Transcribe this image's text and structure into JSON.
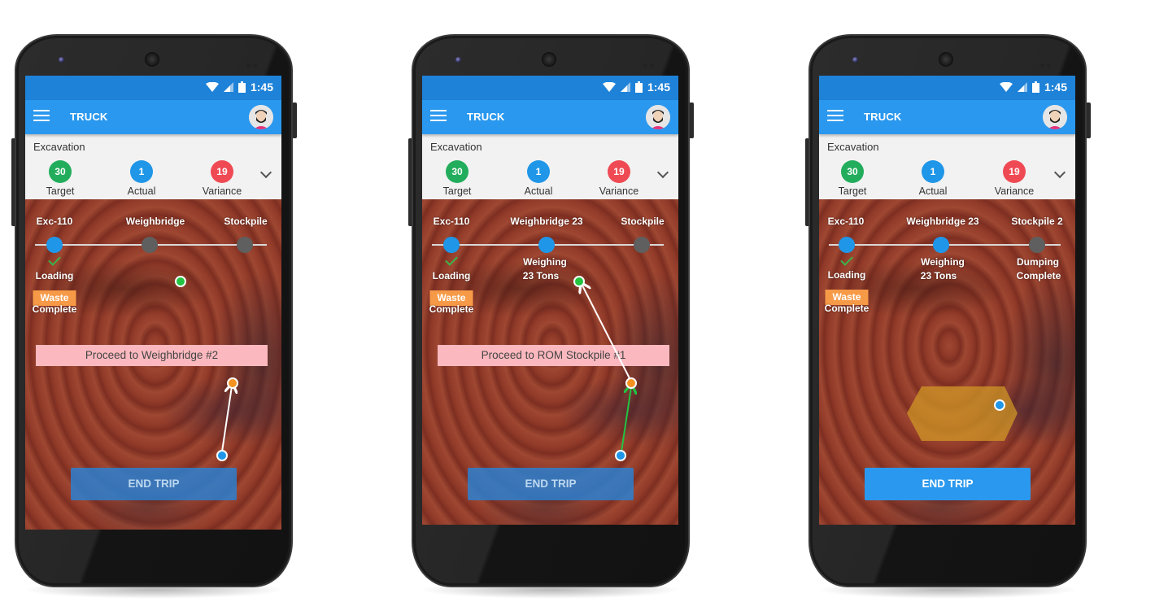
{
  "colors": {
    "statusbar": "#1e82d8",
    "appbar": "#2a98ee",
    "target": "#22ad5c",
    "actual": "#1f96e8",
    "variance": "#ef4a54",
    "waste_badge": "#f79a48",
    "banner_bg": "#fbb9bf",
    "active_node": "#1f96e8",
    "idle_node": "#5f5f5f",
    "geofence": "#d39a26"
  },
  "phones": [
    {
      "status": {
        "time": "1:45",
        "icons": [
          "wifi-icon",
          "signal-icon",
          "battery-icon"
        ]
      },
      "appbar": {
        "menu_icon": "hamburger-menu-icon",
        "title": "TRUCK",
        "avatar": "user-avatar"
      },
      "stats": {
        "section": "Excavation",
        "items": [
          {
            "value": "30",
            "label": "Target"
          },
          {
            "value": "1",
            "label": "Actual"
          },
          {
            "value": "19",
            "label": "Variance"
          }
        ],
        "expand_icon": "chevron-down-icon"
      },
      "steps": [
        {
          "title": "Exc-110",
          "state": "active",
          "done": true,
          "sub": "Loading",
          "badge": "Waste",
          "sub2": "Complete"
        },
        {
          "title": "Weighbridge",
          "state": "idle"
        },
        {
          "title": "Stockpile",
          "state": "idle"
        }
      ],
      "banner": "Proceed to Weighbridge #2",
      "end_trip": {
        "label": "END TRIP",
        "enabled": false
      }
    },
    {
      "status": {
        "time": "1:45",
        "icons": [
          "wifi-icon",
          "signal-icon",
          "battery-icon"
        ]
      },
      "appbar": {
        "menu_icon": "hamburger-menu-icon",
        "title": "TRUCK",
        "avatar": "user-avatar"
      },
      "stats": {
        "section": "Excavation",
        "items": [
          {
            "value": "30",
            "label": "Target"
          },
          {
            "value": "1",
            "label": "Actual"
          },
          {
            "value": "19",
            "label": "Variance"
          }
        ],
        "expand_icon": "chevron-down-icon"
      },
      "steps": [
        {
          "title": "Exc-110",
          "state": "active",
          "done": true,
          "sub": "Loading",
          "badge": "Waste",
          "sub2": "Complete"
        },
        {
          "title": "Weighbridge 23",
          "state": "active",
          "sub": "Weighing",
          "sub2": "23 Tons"
        },
        {
          "title": "Stockpile",
          "state": "idle"
        }
      ],
      "banner": "Proceed to ROM Stockpile #1",
      "end_trip": {
        "label": "END TRIP",
        "enabled": false
      }
    },
    {
      "status": {
        "time": "1:45",
        "icons": [
          "wifi-icon",
          "signal-icon",
          "battery-icon"
        ]
      },
      "appbar": {
        "menu_icon": "hamburger-menu-icon",
        "title": "TRUCK",
        "avatar": "user-avatar"
      },
      "stats": {
        "section": "Excavation",
        "items": [
          {
            "value": "30",
            "label": "Target"
          },
          {
            "value": "1",
            "label": "Actual"
          },
          {
            "value": "19",
            "label": "Variance"
          }
        ],
        "expand_icon": "chevron-down-icon"
      },
      "steps": [
        {
          "title": "Exc-110",
          "state": "active",
          "done": true,
          "sub": "Loading",
          "badge": "Waste",
          "sub2": "Complete"
        },
        {
          "title": "Weighbridge  23",
          "state": "active",
          "sub": "Weighing",
          "sub2": "23 Tons"
        },
        {
          "title": "Stockpile 2",
          "state": "idle",
          "sub": "Dumping",
          "sub2": "Complete"
        }
      ],
      "end_trip": {
        "label": "END TRIP",
        "enabled": true
      }
    }
  ]
}
